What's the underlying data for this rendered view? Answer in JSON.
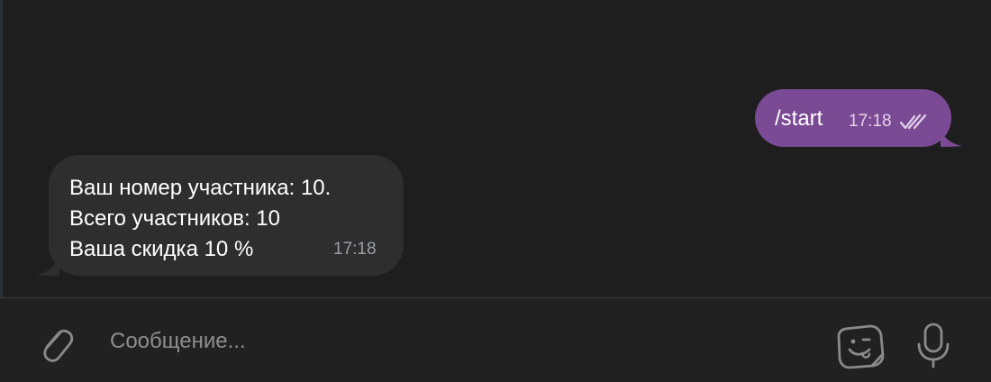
{
  "chat": {
    "outgoing": {
      "text": "/start",
      "time": "17:18",
      "status_icon": "double-check-icon"
    },
    "incoming": {
      "lines": [
        "Ваш номер участника: 10.",
        "Всего участников: 10",
        "Ваша скидка 10 %"
      ],
      "time": "17:18"
    }
  },
  "composer": {
    "placeholder": "Сообщение...",
    "attach_icon": "paperclip-icon",
    "sticker_icon": "sticker-icon",
    "mic_icon": "microphone-icon"
  },
  "colors": {
    "outgoing_bubble": "#7b4a94",
    "incoming_bubble": "#2e2e2e",
    "background": "#1e1e1e"
  }
}
